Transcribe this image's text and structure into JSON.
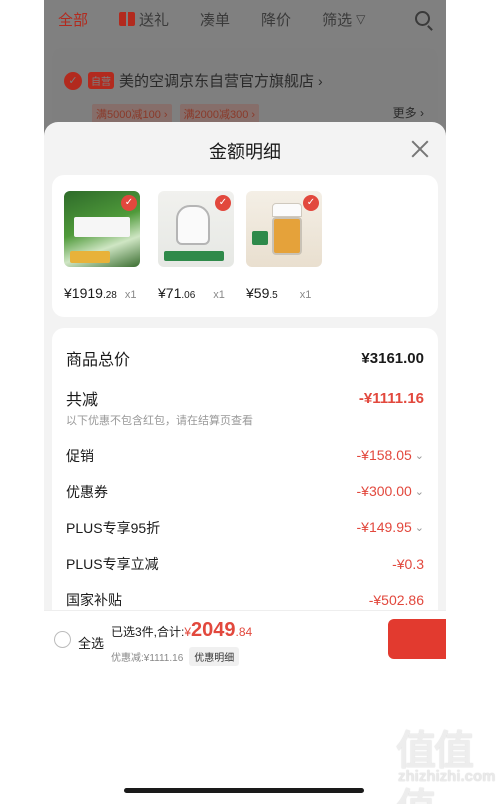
{
  "background": {
    "tabs": [
      {
        "label": "全部",
        "active": true
      },
      {
        "label": "送礼",
        "icon": "gift-icon"
      },
      {
        "label": "凑单"
      },
      {
        "label": "降价"
      },
      {
        "label": "筛选"
      }
    ],
    "filter_icon": "▽",
    "store": {
      "self_tag": "自营",
      "name": "美的空调京东自营官方旗舰店",
      "arrow": "›",
      "coupons": [
        "满5000减100 ›",
        "满2000减300 ›"
      ],
      "more": "更多 ›"
    }
  },
  "sheet": {
    "title": "金额明细",
    "products": [
      {
        "price_int": "¥1919",
        "price_dec": ".28",
        "qty": "x1"
      },
      {
        "price_int": "¥71",
        "price_dec": ".06",
        "qty": "x1"
      },
      {
        "price_int": "¥59",
        "price_dec": ".5",
        "qty": "x1"
      }
    ],
    "detail": {
      "goods_total_label": "商品总价",
      "goods_total_value": "¥3161.00",
      "total_discount_label": "共减",
      "total_discount_value": "-¥1111.16",
      "note": "以下优惠不包含红包，请在结算页查看",
      "items": [
        {
          "label": "促销",
          "value": "-¥158.05",
          "chevron": true
        },
        {
          "label": "优惠券",
          "value": "-¥300.00",
          "chevron": true
        },
        {
          "label": "PLUS专享95折",
          "value": "-¥149.95",
          "chevron": true
        },
        {
          "label": "PLUS专享立减",
          "value": "-¥0.3",
          "chevron": false
        },
        {
          "label": "国家补贴",
          "value": "-¥502.86",
          "chevron": false
        }
      ]
    }
  },
  "bottom_bar": {
    "select_all": "全选",
    "selected_text": "已选3件,合计:",
    "currency": "¥",
    "total_int": "2049",
    "total_dec": ".84",
    "discount_text": "优惠减:¥1111.16",
    "detail_button": "优惠明细"
  },
  "watermark": {
    "glyphs": "值值值",
    "domain": "zhizhizhi.com"
  },
  "colors": {
    "accent": "#e2483d",
    "brand_dim": "#b22a1e"
  }
}
